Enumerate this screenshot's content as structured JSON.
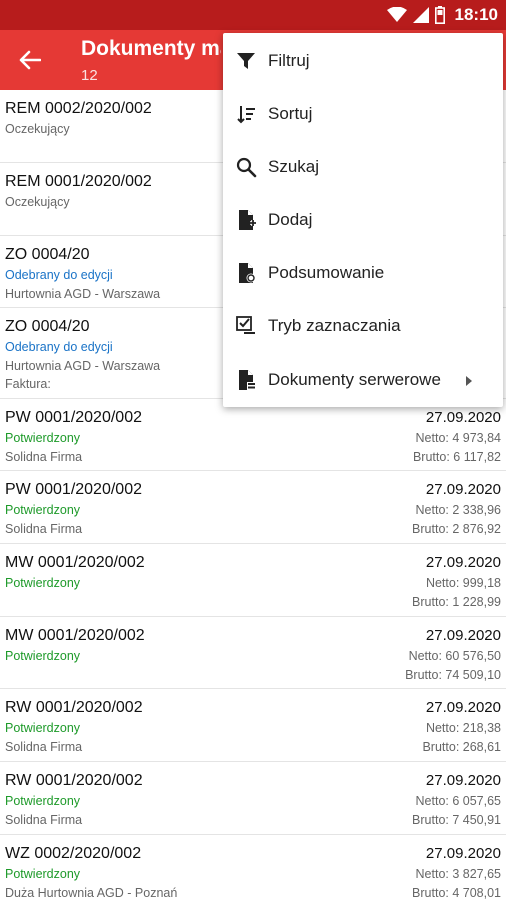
{
  "status_bar": {
    "time": "18:10"
  },
  "app_bar": {
    "title": "Dokumenty magazynowe",
    "subtitle": "12"
  },
  "menu": {
    "items": [
      {
        "label": "Filtruj",
        "icon": "filter-icon"
      },
      {
        "label": "Sortuj",
        "icon": "sort-icon"
      },
      {
        "label": "Szukaj",
        "icon": "search-icon"
      },
      {
        "label": "Dodaj",
        "icon": "add-document-icon"
      },
      {
        "label": "Podsumowanie",
        "icon": "summary-document-icon"
      },
      {
        "label": "Tryb zaznaczania",
        "icon": "checklist-icon"
      },
      {
        "label": "Dokumenty serwerowe",
        "icon": "server-document-icon"
      }
    ]
  },
  "documents": [
    {
      "number": "REM 0002/2020/002",
      "status": "Oczekujący",
      "status_type": "waiting"
    },
    {
      "number": "REM 0001/2020/002",
      "status": "Oczekujący",
      "status_type": "waiting"
    },
    {
      "number": "ZO 0004/20",
      "status": "Odebrany do edycji",
      "status_type": "edit",
      "company": "Hurtownia AGD - Warszawa"
    },
    {
      "number": "ZO 0004/20",
      "status": "Odebrany do edycji",
      "status_type": "edit",
      "company": "Hurtownia AGD - Warszawa",
      "extra": "Faktura:"
    },
    {
      "number": "PW 0001/2020/002",
      "status": "Potwierdzony",
      "status_type": "confirmed",
      "company": "Solidna Firma",
      "date": "27.09.2020",
      "netto": "Netto: 4 973,84",
      "brutto": "Brutto: 6 117,82"
    },
    {
      "number": "PW 0001/2020/002",
      "status": "Potwierdzony",
      "status_type": "confirmed",
      "company": "Solidna Firma",
      "date": "27.09.2020",
      "netto": "Netto: 2 338,96",
      "brutto": "Brutto: 2 876,92"
    },
    {
      "number": "MW 0001/2020/002",
      "status": "Potwierdzony",
      "status_type": "confirmed",
      "date": "27.09.2020",
      "netto": "Netto: 999,18",
      "brutto": "Brutto: 1 228,99"
    },
    {
      "number": "MW 0001/2020/002",
      "status": "Potwierdzony",
      "status_type": "confirmed",
      "date": "27.09.2020",
      "netto": "Netto: 60 576,50",
      "brutto": "Brutto: 74 509,10"
    },
    {
      "number": "RW 0001/2020/002",
      "status": "Potwierdzony",
      "status_type": "confirmed",
      "company": "Solidna Firma",
      "date": "27.09.2020",
      "netto": "Netto: 218,38",
      "brutto": "Brutto: 268,61"
    },
    {
      "number": "RW 0001/2020/002",
      "status": "Potwierdzony",
      "status_type": "confirmed",
      "company": "Solidna Firma",
      "date": "27.09.2020",
      "netto": "Netto: 6 057,65",
      "brutto": "Brutto: 7 450,91"
    },
    {
      "number": "WZ 0002/2020/002",
      "status": "Potwierdzony",
      "status_type": "confirmed",
      "company": "Duża Hurtownia AGD - Poznań",
      "date": "27.09.2020",
      "netto": "Netto: 3 827,65",
      "brutto": "Brutto: 4 708,01"
    }
  ]
}
